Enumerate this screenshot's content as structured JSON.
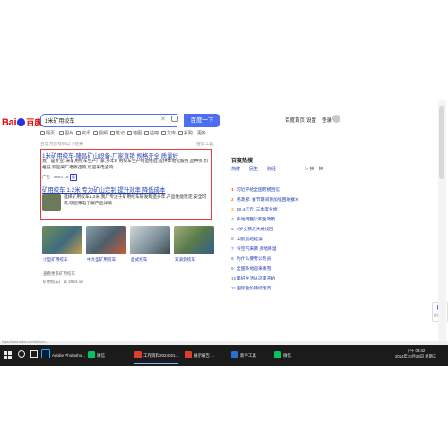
{
  "search": {
    "logo_text": "Bai",
    "logo_text_2": "百度",
    "query": "1米矿用绞车",
    "button_label": "百度一下"
  },
  "header": {
    "links": [
      "百度首页",
      "设置",
      "登录"
    ]
  },
  "tabs": [
    "网页",
    "图片",
    "资讯",
    "视频",
    "笔记",
    "地图",
    "贴吧",
    "文库",
    "采购",
    "更多"
  ],
  "tools_hint": "百度为您找到以下结果",
  "tools_label": "搜索工具",
  "results": [
    {
      "title": "1米矿用绞车-隆昌矿山设备-厂家直销 规格齐全 质量好",
      "body": "我厂是专业1米矿用绞车生产厂家,多年矿用绞车生产制造经验,提供本地化服务,品种多,价格低,欢迎来厂考察选购,欢迎来电咨询",
      "meta": "广告 · 2024-10",
      "badge": "保"
    },
    {
      "title": "矿用绞车 1.2米 专为矿山定制 提升效率 降低成本",
      "body": "选择矿用绞车1.2米,我厂专注于矿用绞车研发制造多年,产品性能稳定,安全可靠,欢迎来电了解产品详情",
      "meta": "广告 · 2024-10",
      "images": [
        {
          "caption": "小型矿用绞车"
        },
        {
          "caption": "中大型矿用绞车"
        },
        {
          "caption": "盘式绞车"
        },
        {
          "caption": "双滚筒绞车"
        }
      ],
      "more": "查看更多矿用绞车",
      "meta2": "矿用绞车厂家 2024-10"
    }
  ],
  "hot": {
    "panel_title": "百度热搜",
    "refresh": "换一换",
    "tabs": [
      "热搜",
      "民生",
      "财经"
    ],
    "items": [
      "习近平给全国劳模回信",
      "民政部: 春节期间将加强困难群众",
      "30.4亿元! 三季度业绩",
      "多地调整公积金政策",
      "6岁女孩走失被找回",
      "山航航班延误",
      "冷空气来袭 多地降温",
      "为什么要考公务员",
      "全国多地迎来降雪",
      "美好生活从这里开始",
      "国际金价持续走高"
    ]
  },
  "side_helper": "反馈",
  "taskbar": {
    "items": [
      "Adobe Photosho...",
      "微信",
      "工作资料2024021...",
      "展示报告 ...",
      "新手工具",
      "微信"
    ],
    "time": "下午 03:42",
    "date": "2024年10月23日 星期三"
  },
  "status_url": "https://www.baidu.com/link?url=..."
}
